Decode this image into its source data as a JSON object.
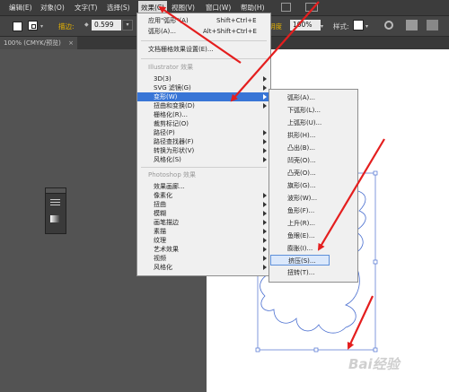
{
  "menubar": {
    "items": [
      "编辑(E)",
      "对象(O)",
      "文字(T)",
      "选择(S)",
      "效果(C)",
      "视图(V)",
      "窗口(W)",
      "帮助(H)"
    ]
  },
  "control_bar": {
    "stroke_label": "描边:",
    "stroke_value": "0.599",
    "opacity_label": "明度",
    "opacity_value": "100%",
    "style_label": "样式:"
  },
  "document_tab": "100% (CMYK/预览)",
  "effect_menu": {
    "apply_last": "应用\"弧形\"(A)",
    "apply_last_shortcut": "Shift+Ctrl+E",
    "last_effect": "弧形(A)...",
    "last_effect_shortcut": "Alt+Shift+Ctrl+E",
    "document_raster": "文档栅格效果设置(E)...",
    "illustrator_header": "Illustrator 效果",
    "illustrator_items": [
      "3D(3)",
      "SVG 滤镜(G)",
      "变形(W)",
      "扭曲和变换(D)",
      "栅格化(R)...",
      "裁剪标记(O)",
      "路径(P)",
      "路径查找器(F)",
      "转换为形状(V)",
      "风格化(S)"
    ],
    "photoshop_header": "Photoshop 效果",
    "photoshop_items": [
      "效果画廊...",
      "像素化",
      "扭曲",
      "模糊",
      "画笔描边",
      "素描",
      "纹理",
      "艺术效果",
      "视频",
      "风格化"
    ]
  },
  "warp_submenu": {
    "items": [
      "弧形(A)...",
      "下弧形(L)...",
      "上弧形(U)...",
      "拱形(H)...",
      "凸出(B)...",
      "凹壳(O)...",
      "凸壳(O)...",
      "旗形(G)...",
      "波形(W)...",
      "鱼形(F)...",
      "上升(R)...",
      "鱼眼(E)...",
      "膨胀(I)...",
      "挤压(S)...",
      "扭转(T)..."
    ],
    "selected": "挤压(S)..."
  },
  "watermark": "Bai经验"
}
